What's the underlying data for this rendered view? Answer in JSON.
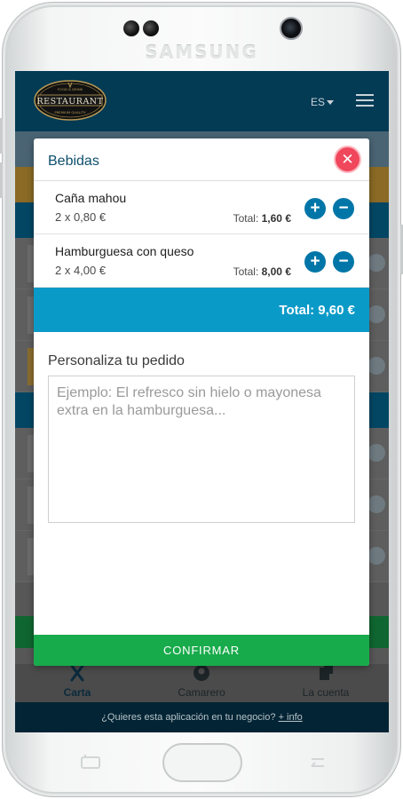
{
  "device": {
    "brand": "SAMSUNG"
  },
  "app": {
    "logo_text": "RESTAURANT",
    "logo_top_text": "FOOD & DRINK",
    "logo_bottom_text": "PREMIUM QUALITY",
    "language": "ES"
  },
  "modal": {
    "title": "Bebidas",
    "items": [
      {
        "name": "Caña mahou",
        "quantity": "2 x 0,80 €",
        "total_label": "Total:",
        "total_value": "1,60 €"
      },
      {
        "name": "Hamburguesa con queso",
        "quantity": "2 x 4,00 €",
        "total_label": "Total:",
        "total_value": "8,00 €"
      }
    ],
    "grand_total": "Total: 9,60 €",
    "customize_label": "Personaliza tu pedido",
    "customize_placeholder": "Ejemplo: El refresco sin hielo o mayonesa extra en la hamburguesa...",
    "confirm_label": "CONFIRMAR"
  },
  "bottom_nav": [
    {
      "label": "Carta",
      "icon": "cutlery-icon"
    },
    {
      "label": "Camarero",
      "icon": "waiter-icon"
    },
    {
      "label": "La cuenta",
      "icon": "bill-icon"
    }
  ],
  "promo": {
    "text": "¿Quieres esta aplicación en tu negocio?",
    "link": "+ info"
  },
  "colors": {
    "appbar": "#033a54",
    "close": "#f0475c",
    "round_button": "#0076a8",
    "total_bar": "#0a9ac8",
    "confirm": "#18ab4b"
  }
}
